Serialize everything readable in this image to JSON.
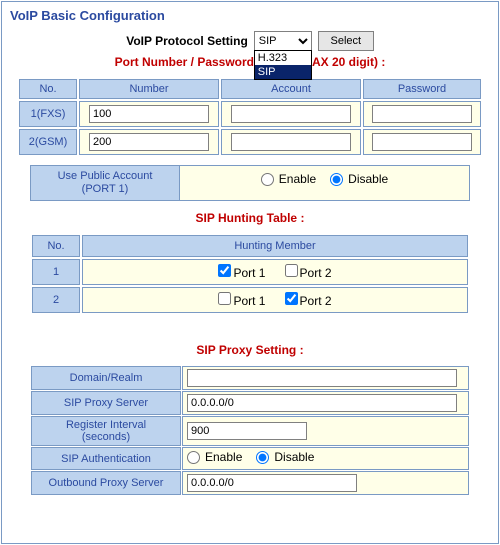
{
  "title": "VoIP Basic Configuration",
  "protocol": {
    "label": "VoIP Protocol Setting",
    "selected": "SIP",
    "options": [
      "H.323",
      "SIP"
    ],
    "select_button": "Select"
  },
  "port_header": "Port Number / Password Setting(MAX 20 digit) :",
  "port_table": {
    "headers": {
      "no": "No.",
      "number": "Number",
      "account": "Account",
      "password": "Password"
    },
    "rows": [
      {
        "no": "1(FXS)",
        "number": "100",
        "account": "",
        "password": ""
      },
      {
        "no": "2(GSM)",
        "number": "200",
        "account": "",
        "password": ""
      }
    ]
  },
  "public_account": {
    "label_line1": "Use Public Account",
    "label_line2": "(PORT 1)",
    "enable": "Enable",
    "disable": "Disable",
    "value": "disable"
  },
  "hunting": {
    "title": "SIP Hunting Table :",
    "headers": {
      "no": "No.",
      "member": "Hunting Member"
    },
    "port_labels": [
      "Port 1",
      "Port 2"
    ],
    "rows": [
      {
        "no": "1",
        "ports": [
          true,
          false
        ]
      },
      {
        "no": "2",
        "ports": [
          false,
          true
        ]
      }
    ]
  },
  "proxy": {
    "title": "SIP Proxy Setting :",
    "domain_label": "Domain/Realm",
    "domain_value": "",
    "server_label": "SIP Proxy Server",
    "server_value": "0.0.0.0/0",
    "interval_label_line1": "Register Interval",
    "interval_label_line2": "(seconds)",
    "interval_value": "900",
    "auth_label": "SIP Authentication",
    "auth_enable": "Enable",
    "auth_disable": "Disable",
    "auth_value": "disable",
    "outbound_label": "Outbound Proxy Server",
    "outbound_value": "0.0.0.0/0"
  }
}
